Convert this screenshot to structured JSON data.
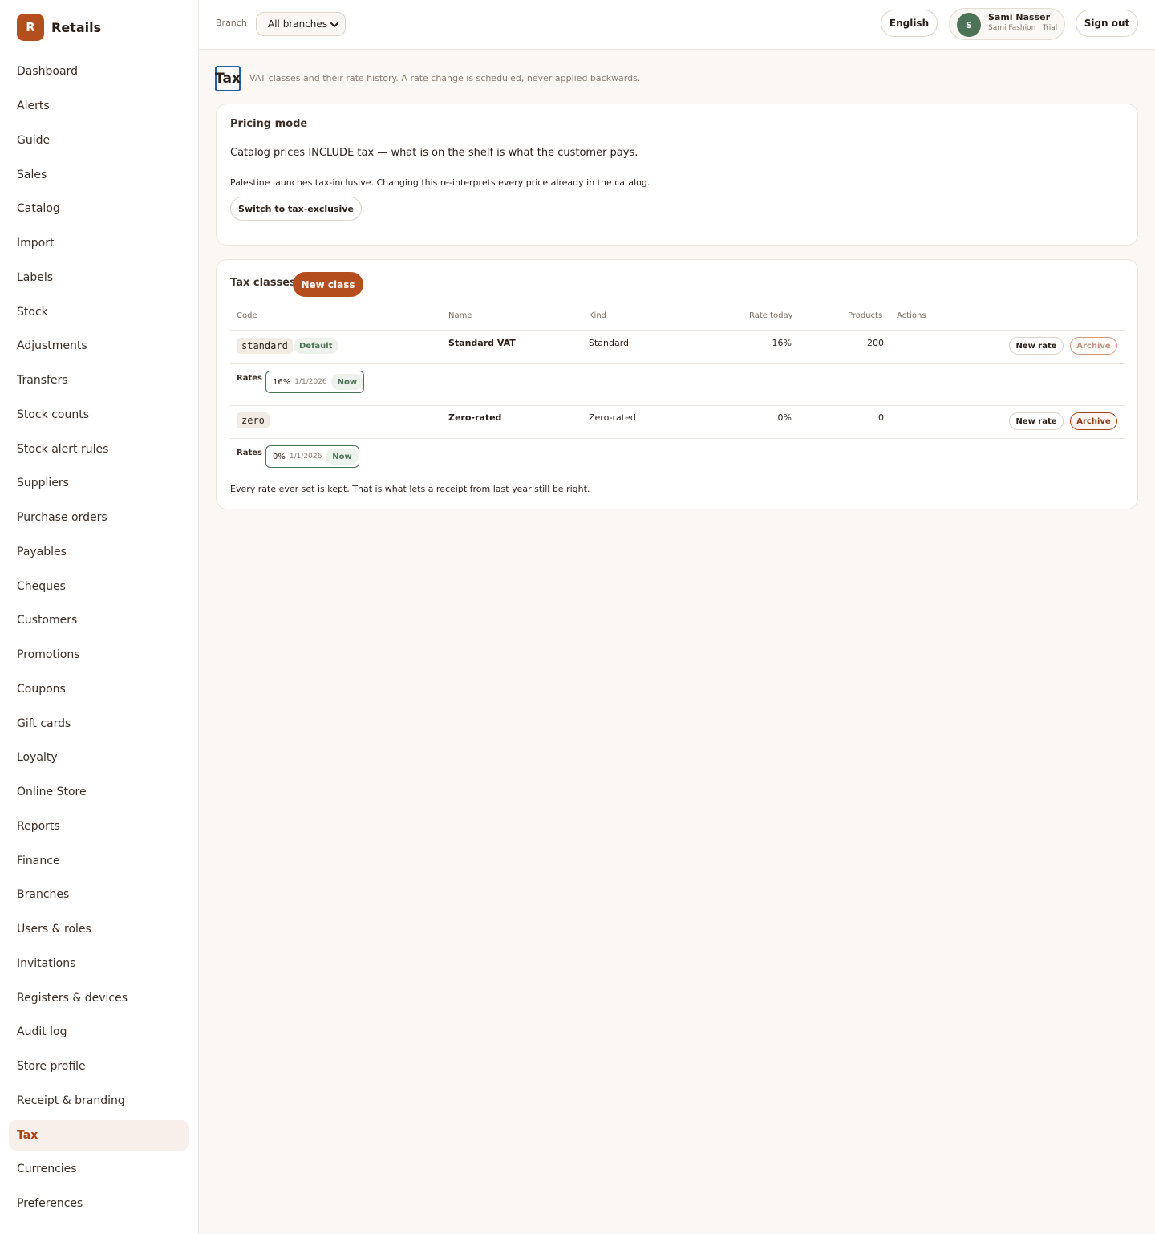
{
  "app": {
    "logo_letter": "R",
    "name": "Retails"
  },
  "sidebar": {
    "items": [
      {
        "label": "Dashboard"
      },
      {
        "label": "Alerts"
      },
      {
        "label": "Guide"
      },
      {
        "label": "Sales"
      },
      {
        "label": "Catalog"
      },
      {
        "label": "Import"
      },
      {
        "label": "Labels"
      },
      {
        "label": "Stock"
      },
      {
        "label": "Adjustments"
      },
      {
        "label": "Transfers"
      },
      {
        "label": "Stock counts"
      },
      {
        "label": "Stock alert rules"
      },
      {
        "label": "Suppliers"
      },
      {
        "label": "Purchase orders"
      },
      {
        "label": "Payables"
      },
      {
        "label": "Cheques"
      },
      {
        "label": "Customers"
      },
      {
        "label": "Promotions"
      },
      {
        "label": "Coupons"
      },
      {
        "label": "Gift cards"
      },
      {
        "label": "Loyalty"
      },
      {
        "label": "Online Store"
      },
      {
        "label": "Reports"
      },
      {
        "label": "Finance"
      },
      {
        "label": "Branches"
      },
      {
        "label": "Users & roles"
      },
      {
        "label": "Invitations"
      },
      {
        "label": "Registers & devices"
      },
      {
        "label": "Audit log"
      },
      {
        "label": "Store profile"
      },
      {
        "label": "Receipt & branding"
      },
      {
        "label": "Tax",
        "active": true
      },
      {
        "label": "Currencies"
      },
      {
        "label": "Preferences"
      }
    ]
  },
  "topbar": {
    "branch_label": "Branch",
    "branch_value": "All branches",
    "language_label": "English",
    "user": {
      "initial": "S",
      "name": "Sami Nasser",
      "subtitle": "Sami Fashion · Trial"
    },
    "signout_label": "Sign out"
  },
  "page": {
    "title": "Tax",
    "subtitle": "VAT classes and their rate history. A rate change is scheduled, never applied backwards."
  },
  "pricing": {
    "title": "Pricing mode",
    "mode_text": "Catalog prices INCLUDE tax — what is on the shelf is what the customer pays.",
    "note": "Palestine launches tax-inclusive. Changing this re-interprets every price already in the catalog.",
    "switch_label": "Switch to tax-exclusive"
  },
  "tax_classes": {
    "title": "Tax classes",
    "new_class_label": "New class",
    "columns": {
      "code": "Code",
      "name": "Name",
      "kind": "Kind",
      "rate_today": "Rate today",
      "products": "Products",
      "actions": "Actions"
    },
    "rows": [
      {
        "code": "standard",
        "default_badge": "Default",
        "name": "Standard VAT",
        "kind": "Standard",
        "rate_today": "16%",
        "products": "200",
        "new_rate_label": "New rate",
        "archive_label": "Archive",
        "rates_label": "Rates",
        "rates": [
          {
            "value": "16%",
            "date": "1/1/2026",
            "status": "Now"
          }
        ]
      },
      {
        "code": "zero",
        "name": "Zero-rated",
        "kind": "Zero-rated",
        "rate_today": "0%",
        "products": "0",
        "new_rate_label": "New rate",
        "archive_label": "Archive",
        "rates_label": "Rates",
        "rates": [
          {
            "value": "0%",
            "date": "1/1/2026",
            "status": "Now"
          }
        ]
      }
    ],
    "footnote": "Every rate ever set is kept. That is what lets a receipt from last year still be right."
  },
  "colors": {
    "accent": "#b54e1e",
    "success": "#4d7356",
    "background": "#faf7f4",
    "focus": "#1f5fae"
  }
}
